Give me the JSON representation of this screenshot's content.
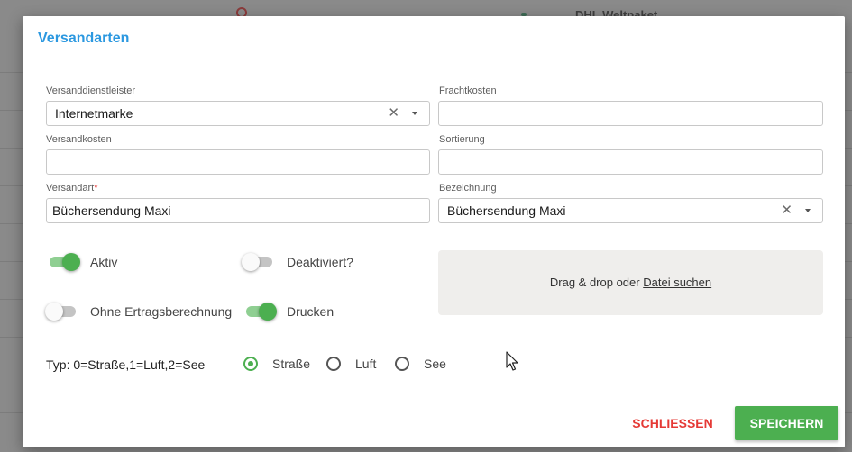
{
  "background": {
    "header_text": "DHL Weltpaket"
  },
  "dialog": {
    "title": "Versandarten",
    "fields": {
      "versanddienstleister": {
        "label": "Versanddienstleister",
        "value": "Internetmarke"
      },
      "frachtkosten": {
        "label": "Frachtkosten",
        "value": ""
      },
      "versandkosten": {
        "label": "Versandkosten",
        "value": ""
      },
      "sortierung": {
        "label": "Sortierung",
        "value": ""
      },
      "versandart": {
        "label": "Versandart",
        "required_mark": "*",
        "value": "Büchersendung Maxi"
      },
      "bezeichnung": {
        "label": "Bezeichnung",
        "value": "Büchersendung Maxi"
      }
    },
    "toggles": {
      "aktiv": {
        "label": "Aktiv",
        "on": true
      },
      "deaktiviert": {
        "label": "Deaktiviert?",
        "on": false
      },
      "ohne_ertrag": {
        "label": "Ohne Ertragsberechnung",
        "on": false
      },
      "drucken": {
        "label": "Drucken",
        "on": true
      }
    },
    "dropzone": {
      "text": "Drag & drop oder",
      "link": "Datei suchen"
    },
    "typ": {
      "label": "Typ: 0=Straße,1=Luft,2=See",
      "options": [
        {
          "label": "Straße",
          "checked": true
        },
        {
          "label": "Luft",
          "checked": false
        },
        {
          "label": "See",
          "checked": false
        }
      ]
    },
    "buttons": {
      "close": "SCHLIESSEN",
      "save": "SPEICHERN"
    },
    "icons": {
      "clear": "close-icon",
      "dropdown": "chevron-down-icon"
    },
    "colors": {
      "accent": "#2b98e0",
      "primary": "#4caf50",
      "danger": "#e53935"
    }
  }
}
